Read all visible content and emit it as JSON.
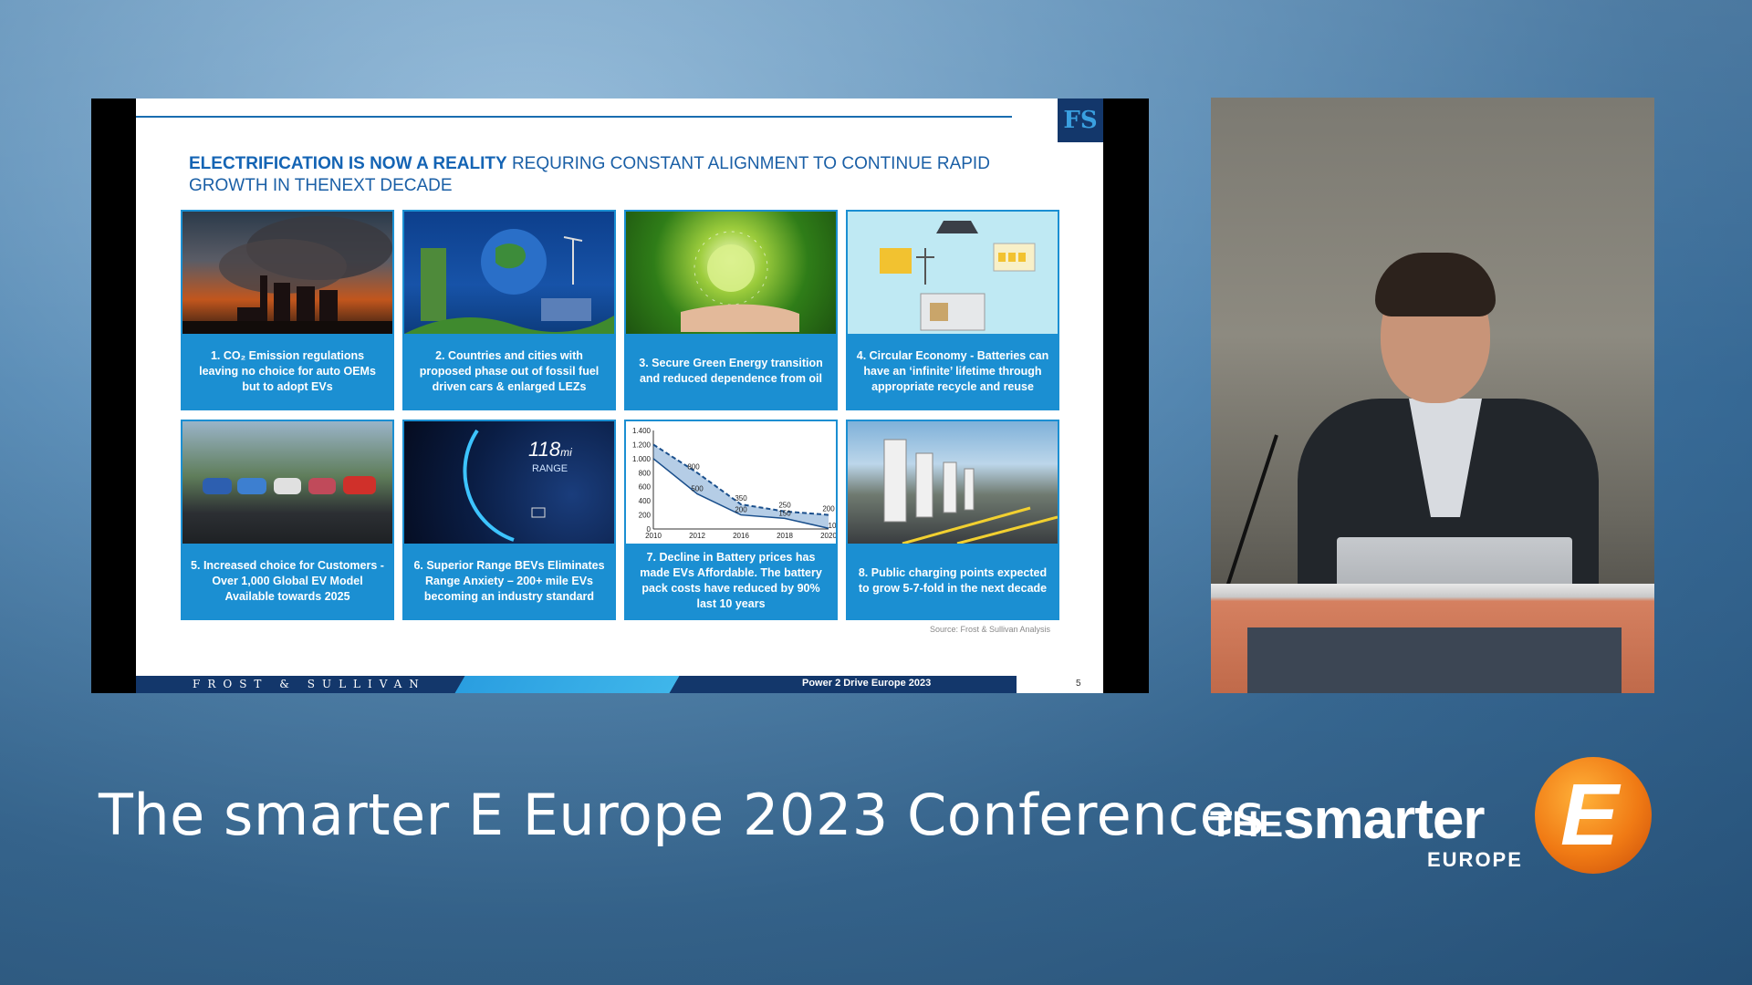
{
  "slide": {
    "title_bold": "ELECTRIFICATION IS NOW A REALITY",
    "title_rest": " REQURING CONSTANT ALIGNMENT TO CONTINUE RAPID GROWTH IN THENEXT DECADE",
    "logo_text": "FS",
    "source": "Source: Frost & Sullivan Analysis",
    "footer_brand": "FROST & SULLIVAN",
    "footer_event": "Power 2 Drive Europe 2023",
    "page_number": "5",
    "cards": [
      {
        "caption": "1. CO₂ Emission regulations leaving no choice for auto OEMs but to adopt EVs",
        "image": "power-plant-smoke"
      },
      {
        "caption": "2. Countries and cities with proposed phase out of fossil fuel driven cars & enlarged LEZs",
        "image": "green-city-globe"
      },
      {
        "caption": "3. Secure Green Energy transition and reduced dependence from oil",
        "image": "hand-holding-globe"
      },
      {
        "caption": "4. Circular Economy - Batteries can have an ‘infinite’ lifetime through appropriate recycle and reuse",
        "image": "battery-recycling"
      },
      {
        "caption": "5. Increased choice for Customers - Over 1,000 Global EV Model Available towards 2025",
        "image": "parked-cars"
      },
      {
        "caption": "6. Superior Range BEVs Eliminates Range Anxiety – 200+ mile EVs becoming an industry standard",
        "image": "range-dashboard"
      },
      {
        "caption": "7. Decline in Battery prices has made EVs Affordable. The battery pack costs have reduced by 90% last 10 years",
        "image": "battery-price-chart"
      },
      {
        "caption": "8. Public charging points expected to grow 5-7-fold in the next decade",
        "image": "charging-stations"
      }
    ],
    "range_display": {
      "value": "118",
      "unit": "mi",
      "label": "RANGE"
    }
  },
  "chart_data": {
    "type": "area",
    "x": [
      "2010",
      "2012",
      "2016",
      "2018",
      "2020"
    ],
    "y_ticks": [
      "0",
      "200",
      "400",
      "600",
      "800",
      "1.000",
      "1.200",
      "1.400"
    ],
    "ylim": [
      0,
      1400
    ],
    "series": [
      {
        "values": [
          1200,
          800,
          350,
          250,
          200
        ]
      },
      {
        "values": [
          1000,
          500,
          200,
          150,
          10
        ]
      }
    ],
    "labels": [
      "800",
      "350",
      "250",
      "200",
      "500",
      "200",
      "150",
      "10"
    ]
  },
  "conference": {
    "title": "The smarter E Europe 2023 Conferences"
  },
  "logo": {
    "the": "THE",
    "smarter": "smarter",
    "e": "E",
    "europe": "EUROPE",
    "accent_color": "#f07a14"
  }
}
